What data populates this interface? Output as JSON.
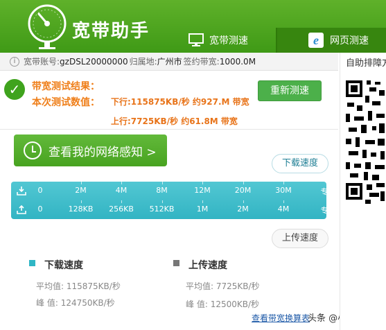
{
  "header": {
    "title": "宽带助手",
    "tabs": [
      {
        "label": "宽带测速",
        "icon": "monitor-icon"
      },
      {
        "label": "网页测速",
        "icon": "ie-browser-icon"
      }
    ]
  },
  "info_bar": {
    "account_label": "宽带账号:",
    "account_value": "gzDSL20000000",
    "location_label": "归属地:",
    "location_value": "广州市",
    "bandwidth_label": "签约带宽:",
    "bandwidth_value": "1000.0M"
  },
  "result": {
    "title": "带宽测试结果：",
    "subtitle": "本次测试数值：",
    "download_text": "下行:115875KB/秒 约927.M 带宽",
    "upload_text": "上行:7725KB/秒 约61.8M 带宽",
    "retest_label": "重新测速"
  },
  "perception_button": {
    "label": "查看我的网络感知 >"
  },
  "tags": {
    "download": "下载速度",
    "upload": "上传速度"
  },
  "scale": {
    "download_ticks": [
      "0",
      "2M",
      "4M",
      "8M",
      "12M",
      "20M",
      "30M",
      "专线"
    ],
    "upload_ticks": [
      "0",
      "128KB",
      "256KB",
      "512KB",
      "1M",
      "2M",
      "4M",
      "专线"
    ]
  },
  "stats": {
    "download": {
      "title": "下载速度",
      "avg_label": "平均值:",
      "avg_value": "115875KB/秒",
      "peak_label": "峰 值:",
      "peak_value": "124750KB/秒"
    },
    "upload": {
      "title": "上传速度",
      "avg_label": "平均值:",
      "avg_value": "7725KB/秒",
      "peak_label": "峰 值:",
      "peak_value": "12500KB/秒"
    }
  },
  "footer": {
    "link": "查看带宽换算表",
    "watermark": "头条 @小神龙X"
  },
  "right_panel": {
    "title": "自助排障方"
  },
  "colors": {
    "header_green": "#4aa31d",
    "accent_orange": "#ef7f1a",
    "scale_cyan": "#3ab9c8",
    "button_green": "#4cb04a"
  }
}
